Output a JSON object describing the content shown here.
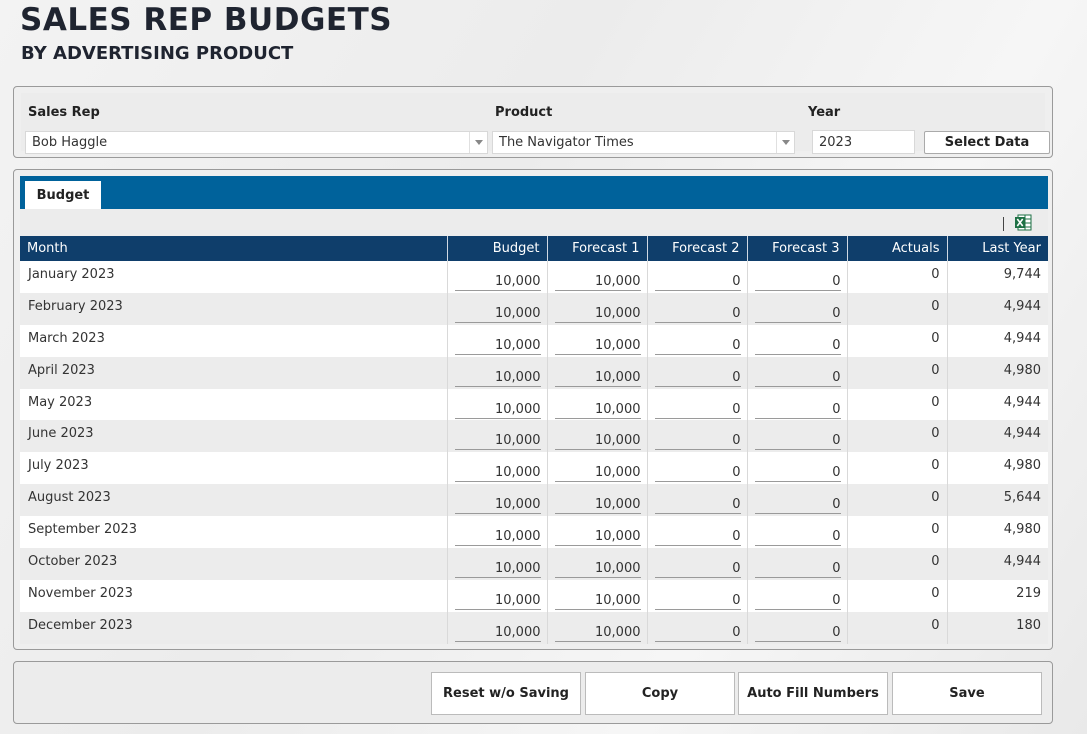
{
  "header": {
    "title": "SALES REP BUDGETS",
    "subtitle": "BY ADVERTISING PRODUCT"
  },
  "filters": {
    "sales_rep_label": "Sales Rep",
    "sales_rep_value": "Bob Haggle",
    "product_label": "Product",
    "product_value": "The Navigator Times",
    "year_label": "Year",
    "year_value": "2023",
    "select_data_label": "Select Data"
  },
  "tabs": [
    {
      "label": "Budget",
      "active": true
    }
  ],
  "toolbar": {
    "excel_icon": "excel-icon"
  },
  "grid": {
    "columns": [
      "Month",
      "Budget",
      "Forecast 1",
      "Forecast 2",
      "Forecast 3",
      "Actuals",
      "Last Year"
    ],
    "rows": [
      {
        "month": "January 2023",
        "budget": "10,000",
        "f1": "10,000",
        "f2": "0",
        "f3": "0",
        "actuals": "0",
        "last_year": "9,744"
      },
      {
        "month": "February 2023",
        "budget": "10,000",
        "f1": "10,000",
        "f2": "0",
        "f3": "0",
        "actuals": "0",
        "last_year": "4,944"
      },
      {
        "month": "March 2023",
        "budget": "10,000",
        "f1": "10,000",
        "f2": "0",
        "f3": "0",
        "actuals": "0",
        "last_year": "4,944"
      },
      {
        "month": "April 2023",
        "budget": "10,000",
        "f1": "10,000",
        "f2": "0",
        "f3": "0",
        "actuals": "0",
        "last_year": "4,980"
      },
      {
        "month": "May 2023",
        "budget": "10,000",
        "f1": "10,000",
        "f2": "0",
        "f3": "0",
        "actuals": "0",
        "last_year": "4,944"
      },
      {
        "month": "June 2023",
        "budget": "10,000",
        "f1": "10,000",
        "f2": "0",
        "f3": "0",
        "actuals": "0",
        "last_year": "4,944"
      },
      {
        "month": "July 2023",
        "budget": "10,000",
        "f1": "10,000",
        "f2": "0",
        "f3": "0",
        "actuals": "0",
        "last_year": "4,980"
      },
      {
        "month": "August 2023",
        "budget": "10,000",
        "f1": "10,000",
        "f2": "0",
        "f3": "0",
        "actuals": "0",
        "last_year": "5,644"
      },
      {
        "month": "September 2023",
        "budget": "10,000",
        "f1": "10,000",
        "f2": "0",
        "f3": "0",
        "actuals": "0",
        "last_year": "4,980"
      },
      {
        "month": "October 2023",
        "budget": "10,000",
        "f1": "10,000",
        "f2": "0",
        "f3": "0",
        "actuals": "0",
        "last_year": "4,944"
      },
      {
        "month": "November 2023",
        "budget": "10,000",
        "f1": "10,000",
        "f2": "0",
        "f3": "0",
        "actuals": "0",
        "last_year": "219"
      },
      {
        "month": "December 2023",
        "budget": "10,000",
        "f1": "10,000",
        "f2": "0",
        "f3": "0",
        "actuals": "0",
        "last_year": "180"
      }
    ]
  },
  "actions": {
    "reset_label": "Reset w/o Saving",
    "copy_label": "Copy",
    "autofill_label": "Auto Fill Numbers",
    "save_label": "Save"
  },
  "colors": {
    "tab_bar": "#00629b",
    "grid_header": "#0f3e6b",
    "excel_green": "#1e7145"
  }
}
